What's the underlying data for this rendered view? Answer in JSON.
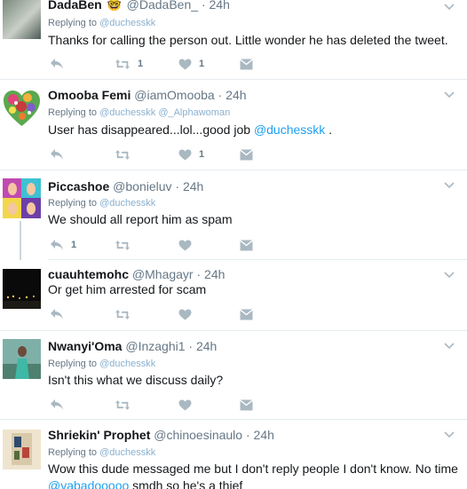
{
  "colors": {
    "link": "#1da1f2",
    "muted": "#657786",
    "separator": "#e6ecf0",
    "icon": "#aab8c2"
  },
  "tweets": [
    {
      "name": "DadaBen",
      "badge": "🤓",
      "handle": "@DadaBen_",
      "dot": "·",
      "time": "24h",
      "replying_label": "Replying to",
      "replying_to": "@duchesskk",
      "replying_to_2": "",
      "text": "Thanks for calling the person out. Little wonder he has deleted the tweet.",
      "retweets": "1",
      "likes": "1",
      "replies": ""
    },
    {
      "name": "Omooba Femi",
      "handle": "@iamOmooba",
      "dot": "·",
      "time": "24h",
      "replying_label": "Replying to",
      "replying_to": "@duchesskk",
      "replying_to_2": "@_Alphawoman",
      "text_pre": "User has disappeared...lol...good job ",
      "text_mention": "@duchesskk",
      "text_post": " .",
      "retweets": "",
      "likes": "1",
      "replies": ""
    },
    {
      "name": "Piccashoe",
      "handle": "@bonieluv",
      "dot": "·",
      "time": "24h",
      "replying_label": "Replying to",
      "replying_to": "@duchesskk",
      "text": "We should all report him as spam",
      "replies": "1",
      "retweets": "",
      "likes": ""
    },
    {
      "name": "cuauhtemohc",
      "handle": "@Mhagayr",
      "dot": "·",
      "time": "24h",
      "text": "Or get him arrested for scam",
      "replies": "",
      "retweets": "",
      "likes": ""
    },
    {
      "name": "Nwanyi'Oma",
      "handle": "@Inzaghi1",
      "dot": "·",
      "time": "24h",
      "replying_label": "Replying to",
      "replying_to": "@duchesskk",
      "text": "Isn't this what we discuss daily?",
      "replies": "",
      "retweets": "",
      "likes": ""
    },
    {
      "name": "Shriekin' Prophet",
      "handle": "@chinoesinaulo",
      "dot": "·",
      "time": "24h",
      "replying_label": "Replying to",
      "replying_to": "@duchesskk",
      "text_line1": "Wow this dude messaged me but I don't reply people I don't know. No time",
      "text_mention": "@vabadooooo",
      "text_line2": " smdh so he's a thief"
    }
  ]
}
